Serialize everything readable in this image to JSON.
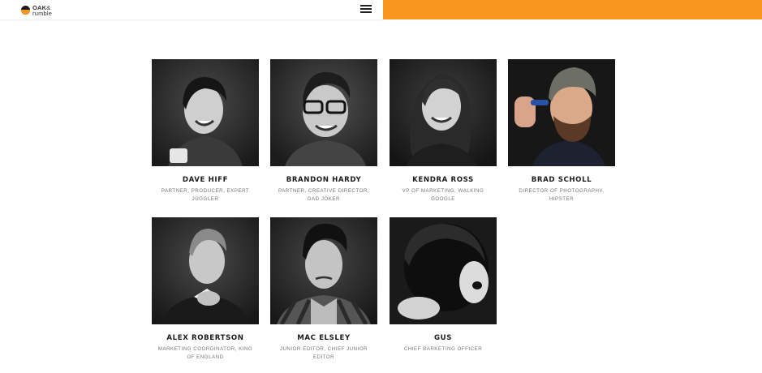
{
  "brand": {
    "logo_line1": "OAK",
    "logo_amp": "&",
    "logo_line2": "rumble",
    "accent_color": "#f6961e"
  },
  "nav": {
    "menu_icon": "hamburger-menu-icon"
  },
  "team": [
    {
      "name": "DAVE HIFF",
      "role": "PARTNER, PRODUCER, EXPERT JUGGLER"
    },
    {
      "name": "BRANDON HARDY",
      "role": "PARTNER, CREATIVE DIRECTOR, DAD JOKER"
    },
    {
      "name": "KENDRA ROSS",
      "role": "VP OF MARKETING, WALKING GOOGLE"
    },
    {
      "name": "BRAD SCHOLL",
      "role": "DIRECTOR OF PHOTOGRAPHY, HIPSTER"
    },
    {
      "name": "ALEX ROBERTSON",
      "role": "MARKETING COORDINATOR, KING OF ENGLAND"
    },
    {
      "name": "MAC ELSLEY",
      "role": "JUNIOR EDITOR, CHIEF JUNIOR EDITOR"
    },
    {
      "name": "GUS",
      "role": "CHIEF BARKETING OFFICER"
    }
  ]
}
